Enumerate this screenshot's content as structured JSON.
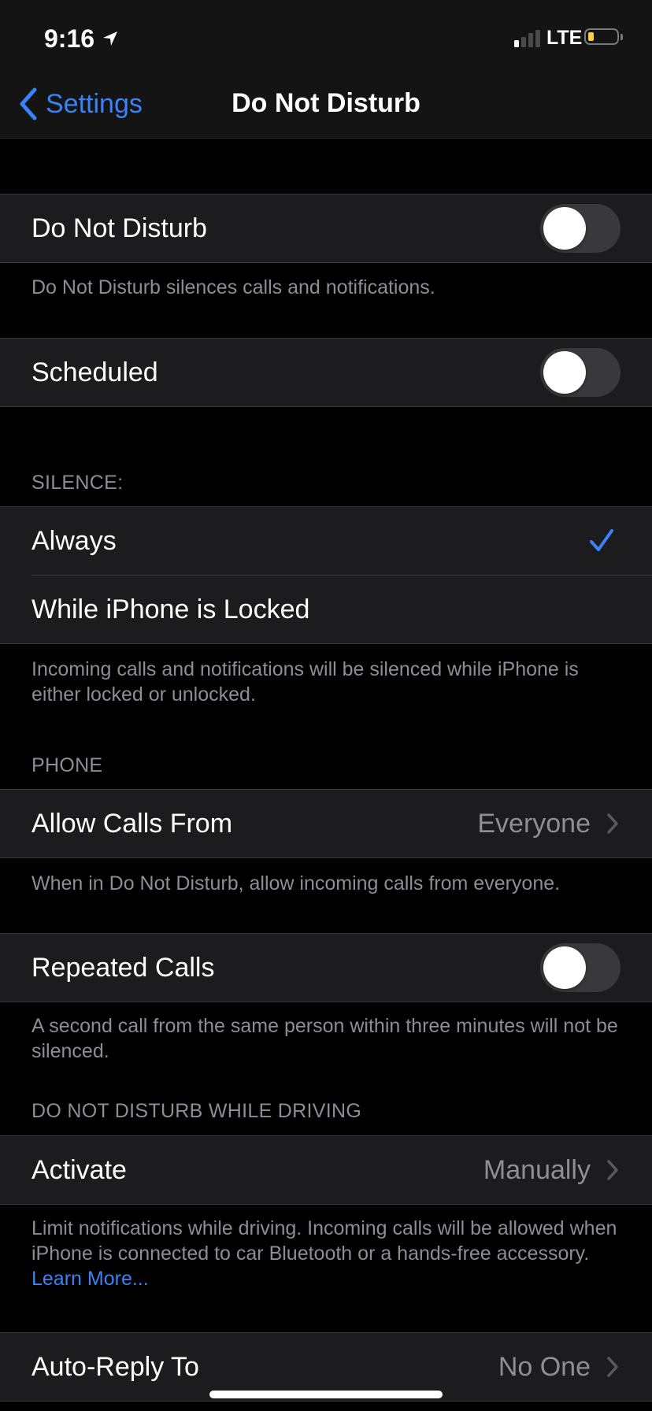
{
  "status_bar": {
    "time": "9:16",
    "location_icon": "location-arrow-icon",
    "signal_bars_active": 1,
    "signal_bars_total": 4,
    "network": "LTE",
    "battery_level": 0.2,
    "battery_color": "#f5d13e"
  },
  "nav": {
    "back_label": "Settings",
    "back_icon": "chevron-left-icon",
    "title": "Do Not Disturb"
  },
  "colors": {
    "accent": "#3a82f7",
    "cell_background": "#1c1c1e",
    "toggle_off_track": "#39393d",
    "secondary_text": "#8e8e93"
  },
  "sections": {
    "dnd": {
      "label": "Do Not Disturb",
      "enabled": false,
      "footer": "Do Not Disturb silences calls and notifications."
    },
    "scheduled": {
      "label": "Scheduled",
      "enabled": false
    },
    "silence": {
      "header": "SILENCE:",
      "options": [
        {
          "label": "Always",
          "selected": true
        },
        {
          "label": "While iPhone is Locked",
          "selected": false
        }
      ],
      "footer": "Incoming calls and notifications will be silenced while iPhone is either locked or unlocked."
    },
    "phone": {
      "header": "PHONE",
      "allow_calls_from": {
        "label": "Allow Calls From",
        "value": "Everyone"
      },
      "allow_footer": "When in Do Not Disturb, allow incoming calls from everyone.",
      "repeated_calls": {
        "label": "Repeated Calls",
        "enabled": false
      },
      "repeated_footer": "A second call from the same person within three minutes will not be silenced."
    },
    "driving": {
      "header": "DO NOT DISTURB WHILE DRIVING",
      "activate": {
        "label": "Activate",
        "value": "Manually"
      },
      "footer": "Limit notifications while driving. Incoming calls will be allowed when iPhone is connected to car Bluetooth or a hands-free accessory.",
      "learn_more": "Learn More...",
      "auto_reply": {
        "label": "Auto-Reply To",
        "value": "No One"
      }
    }
  }
}
